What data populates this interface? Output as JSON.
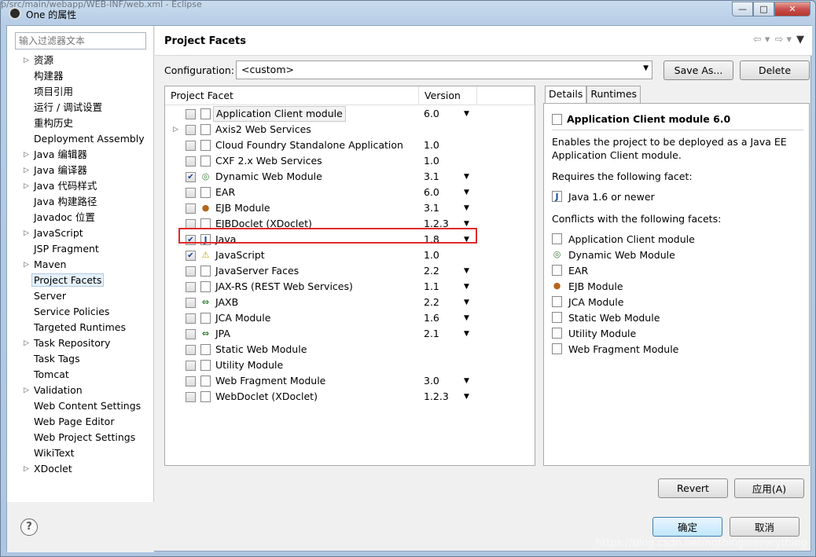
{
  "window": {
    "title": "One 的属性",
    "background_path": "p/src/main/webapp/WEB-INF/web.xml - Eclipse",
    "minimize": "—",
    "maximize": "□",
    "close": "✕"
  },
  "nav": {
    "filter_placeholder": "输入过滤器文本",
    "items": [
      {
        "label": "资源",
        "expandable": true
      },
      {
        "label": "构建器",
        "expandable": false
      },
      {
        "label": "项目引用",
        "expandable": false
      },
      {
        "label": "运行 / 调试设置",
        "expandable": false
      },
      {
        "label": "重构历史",
        "expandable": false
      },
      {
        "label": "Deployment Assembly",
        "expandable": false
      },
      {
        "label": "Java 编辑器",
        "expandable": true
      },
      {
        "label": "Java 编译器",
        "expandable": true
      },
      {
        "label": "Java 代码样式",
        "expandable": true
      },
      {
        "label": "Java 构建路径",
        "expandable": false
      },
      {
        "label": "Javadoc 位置",
        "expandable": false
      },
      {
        "label": "JavaScript",
        "expandable": true
      },
      {
        "label": "JSP Fragment",
        "expandable": false
      },
      {
        "label": "Maven",
        "expandable": true
      },
      {
        "label": "Project Facets",
        "expandable": false,
        "selected": true
      },
      {
        "label": "Server",
        "expandable": false
      },
      {
        "label": "Service Policies",
        "expandable": false
      },
      {
        "label": "Targeted Runtimes",
        "expandable": false
      },
      {
        "label": "Task Repository",
        "expandable": true
      },
      {
        "label": "Task Tags",
        "expandable": false
      },
      {
        "label": "Tomcat",
        "expandable": false
      },
      {
        "label": "Validation",
        "expandable": true
      },
      {
        "label": "Web Content Settings",
        "expandable": false
      },
      {
        "label": "Web Page Editor",
        "expandable": false
      },
      {
        "label": "Web Project Settings",
        "expandable": false
      },
      {
        "label": "WikiText",
        "expandable": false
      },
      {
        "label": "XDoclet",
        "expandable": true
      }
    ],
    "help": "?"
  },
  "page": {
    "title": "Project Facets",
    "configuration_label": "Configuration:",
    "configuration_value": "<custom>",
    "save_as": "Save As...",
    "delete": "Delete",
    "revert": "Revert",
    "apply": "应用(A)",
    "ok": "确定",
    "cancel": "取消"
  },
  "facets": {
    "col_facet": "Project Facet",
    "col_version": "Version",
    "rows": [
      {
        "name": "Application Client module",
        "version": "6.0",
        "checked": false,
        "icon": "document-icon",
        "dropdown": true,
        "boxed": true
      },
      {
        "name": "Axis2 Web Services",
        "version": "",
        "checked": false,
        "icon": "document-icon",
        "dropdown": false,
        "expandable": true
      },
      {
        "name": "Cloud Foundry Standalone Application",
        "version": "1.0",
        "checked": false,
        "icon": "document-icon",
        "dropdown": false
      },
      {
        "name": "CXF 2.x Web Services",
        "version": "1.0",
        "checked": false,
        "icon": "document-icon",
        "dropdown": false
      },
      {
        "name": "Dynamic Web Module",
        "version": "3.1",
        "checked": true,
        "icon": "globe-icon",
        "dropdown": true
      },
      {
        "name": "EAR",
        "version": "6.0",
        "checked": false,
        "icon": "document-icon",
        "dropdown": true
      },
      {
        "name": "EJB Module",
        "version": "3.1",
        "checked": false,
        "icon": "bean-icon",
        "dropdown": true
      },
      {
        "name": "EJBDoclet (XDoclet)",
        "version": "1.2.3",
        "checked": false,
        "icon": "document-icon",
        "dropdown": true
      },
      {
        "name": "Java",
        "version": "1.8",
        "checked": true,
        "icon": "java-icon",
        "dropdown": true
      },
      {
        "name": "JavaScript",
        "version": "1.0",
        "checked": true,
        "icon": "javascript-icon",
        "dropdown": false
      },
      {
        "name": "JavaServer Faces",
        "version": "2.2",
        "checked": false,
        "icon": "document-icon",
        "dropdown": true
      },
      {
        "name": "JAX-RS (REST Web Services)",
        "version": "1.1",
        "checked": false,
        "icon": "document-icon",
        "dropdown": true
      },
      {
        "name": "JAXB",
        "version": "2.2",
        "checked": false,
        "icon": "arrows-icon",
        "dropdown": true
      },
      {
        "name": "JCA Module",
        "version": "1.6",
        "checked": false,
        "icon": "document-icon",
        "dropdown": true
      },
      {
        "name": "JPA",
        "version": "2.1",
        "checked": false,
        "icon": "arrows-icon",
        "dropdown": true
      },
      {
        "name": "Static Web Module",
        "version": "",
        "checked": false,
        "icon": "document-icon",
        "dropdown": false
      },
      {
        "name": "Utility Module",
        "version": "",
        "checked": false,
        "icon": "document-icon",
        "dropdown": false
      },
      {
        "name": "Web Fragment Module",
        "version": "3.0",
        "checked": false,
        "icon": "document-icon",
        "dropdown": true
      },
      {
        "name": "WebDoclet (XDoclet)",
        "version": "1.2.3",
        "checked": false,
        "icon": "document-icon",
        "dropdown": true
      }
    ]
  },
  "details": {
    "tab_details": "Details",
    "tab_runtimes": "Runtimes",
    "title": "Application Client module 6.0",
    "description": "Enables the project to be deployed as a Java EE Application Client module.",
    "requires_label": "Requires the following facet:",
    "requires": [
      {
        "name": "Java 1.6 or newer",
        "icon": "java-icon"
      }
    ],
    "conflicts_label": "Conflicts with the following facets:",
    "conflicts": [
      {
        "name": "Application Client module",
        "icon": "document-icon"
      },
      {
        "name": "Dynamic Web Module",
        "icon": "globe-icon"
      },
      {
        "name": "EAR",
        "icon": "document-icon"
      },
      {
        "name": "EJB Module",
        "icon": "bean-icon"
      },
      {
        "name": "JCA Module",
        "icon": "document-icon"
      },
      {
        "name": "Static Web Module",
        "icon": "document-icon"
      },
      {
        "name": "Utility Module",
        "icon": "document-icon"
      },
      {
        "name": "Web Fragment Module",
        "icon": "document-icon"
      }
    ]
  },
  "watermark": "https://blog.csdn.net/nothingiseverything",
  "colors": {
    "highlight": "#e02b2b",
    "selection": "#e5f1fb"
  }
}
